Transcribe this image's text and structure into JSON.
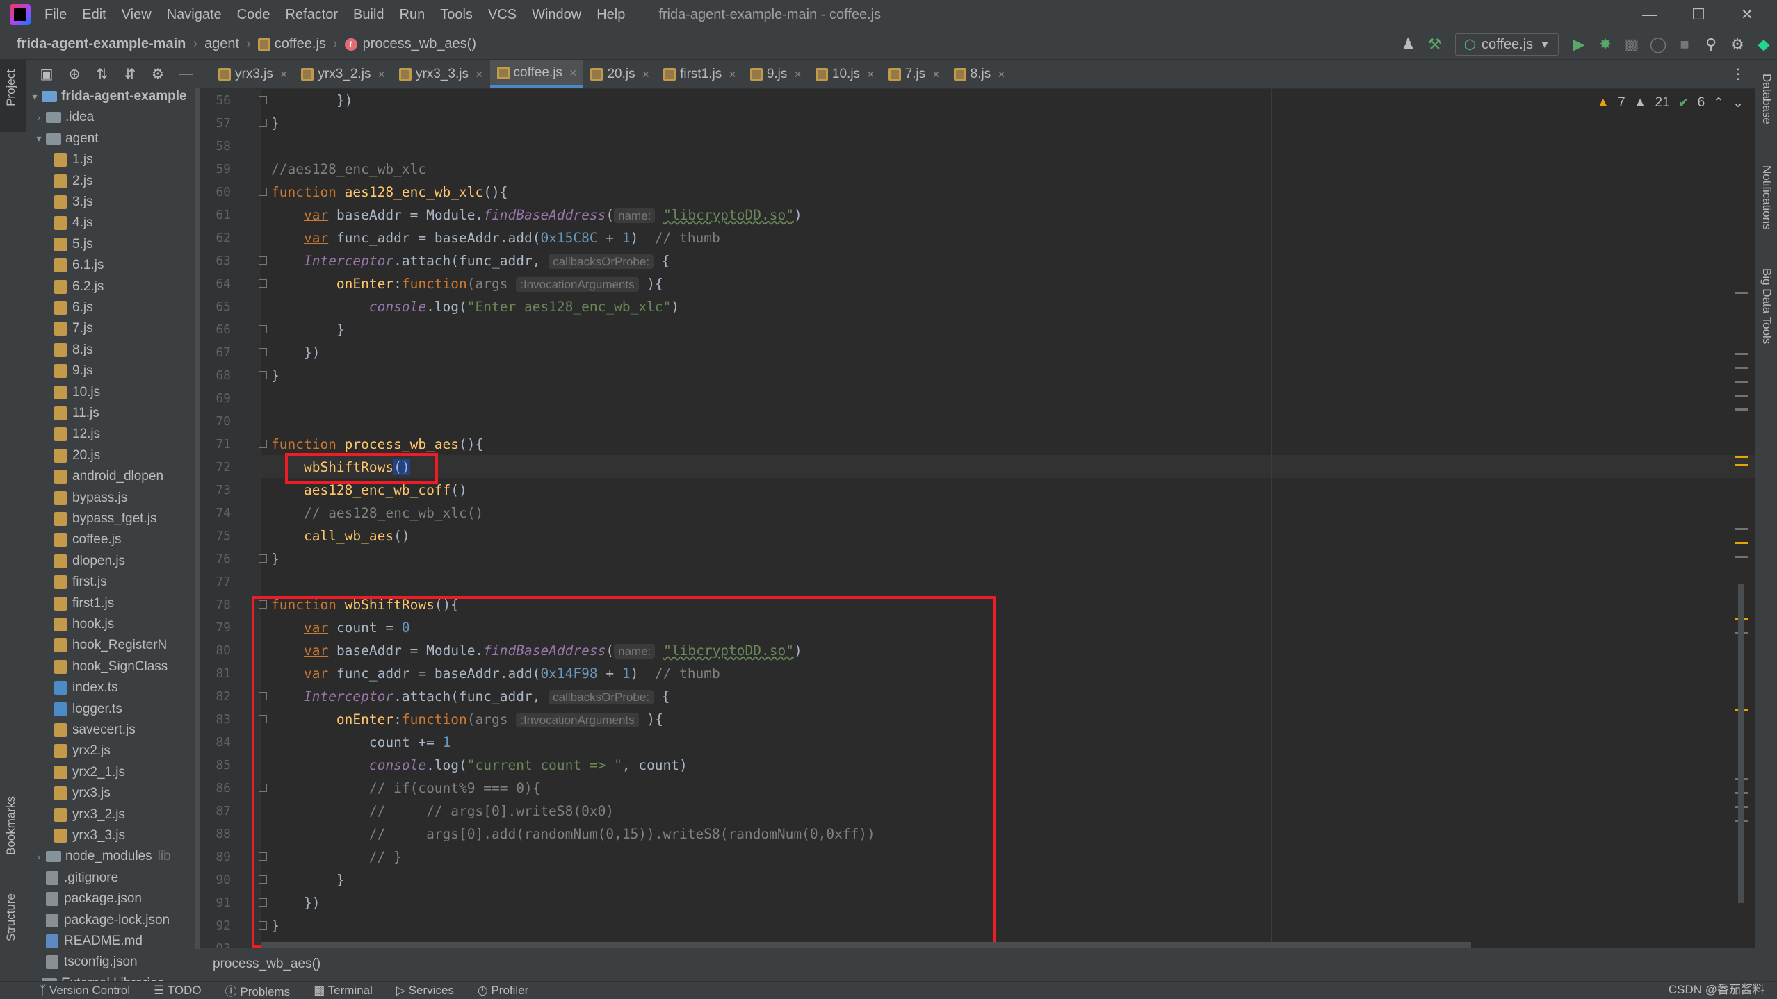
{
  "window": {
    "title": "frida-agent-example-main - coffee.js",
    "minimize": "—",
    "maximize": "☐",
    "close": "✕"
  },
  "menu": [
    "File",
    "Edit",
    "View",
    "Navigate",
    "Code",
    "Refactor",
    "Build",
    "Run",
    "Tools",
    "VCS",
    "Window",
    "Help"
  ],
  "breadcrumb": [
    "frida-agent-example-main",
    "agent",
    "coffee.js",
    "process_wb_aes()"
  ],
  "run_config": "coffee.js",
  "left_stripe": {
    "project": "Project",
    "bookmarks": "Bookmarks",
    "structure": "Structure"
  },
  "right_stripe": {
    "database": "Database",
    "notifications": "Notifications",
    "big_data": "Big Data Tools"
  },
  "tabs": [
    {
      "label": "yrx3.js",
      "active": false
    },
    {
      "label": "yrx3_2.js",
      "active": false
    },
    {
      "label": "yrx3_3.js",
      "active": false
    },
    {
      "label": "coffee.js",
      "active": true
    },
    {
      "label": "20.js",
      "active": false
    },
    {
      "label": "first1.js",
      "active": false
    },
    {
      "label": "9.js",
      "active": false
    },
    {
      "label": "10.js",
      "active": false
    },
    {
      "label": "7.js",
      "active": false
    },
    {
      "label": "8.js",
      "active": false
    }
  ],
  "inspections": {
    "warnings": "7",
    "weak_warnings": "21",
    "ok": "6"
  },
  "project_tree": [
    {
      "label": "frida-agent-example",
      "type": "folder-root",
      "depth": 0,
      "arrow": "▾"
    },
    {
      "label": ".idea",
      "type": "folder",
      "depth": 1,
      "arrow": "›"
    },
    {
      "label": "agent",
      "type": "folder",
      "depth": 1,
      "arrow": "▾"
    },
    {
      "label": "1.js",
      "type": "js",
      "depth": 2
    },
    {
      "label": "2.js",
      "type": "js",
      "depth": 2
    },
    {
      "label": "3.js",
      "type": "js",
      "depth": 2
    },
    {
      "label": "4.js",
      "type": "js",
      "depth": 2
    },
    {
      "label": "5.js",
      "type": "js",
      "depth": 2
    },
    {
      "label": "6.1.js",
      "type": "js",
      "depth": 2
    },
    {
      "label": "6.2.js",
      "type": "js",
      "depth": 2
    },
    {
      "label": "6.js",
      "type": "js",
      "depth": 2
    },
    {
      "label": "7.js",
      "type": "js",
      "depth": 2
    },
    {
      "label": "8.js",
      "type": "js",
      "depth": 2
    },
    {
      "label": "9.js",
      "type": "js",
      "depth": 2
    },
    {
      "label": "10.js",
      "type": "js",
      "depth": 2
    },
    {
      "label": "11.js",
      "type": "js",
      "depth": 2
    },
    {
      "label": "12.js",
      "type": "js",
      "depth": 2
    },
    {
      "label": "20.js",
      "type": "js",
      "depth": 2
    },
    {
      "label": "android_dlopen",
      "type": "js",
      "depth": 2
    },
    {
      "label": "bypass.js",
      "type": "js",
      "depth": 2
    },
    {
      "label": "bypass_fget.js",
      "type": "js",
      "depth": 2
    },
    {
      "label": "coffee.js",
      "type": "js",
      "depth": 2
    },
    {
      "label": "dlopen.js",
      "type": "js",
      "depth": 2
    },
    {
      "label": "first.js",
      "type": "js",
      "depth": 2
    },
    {
      "label": "first1.js",
      "type": "js",
      "depth": 2
    },
    {
      "label": "hook.js",
      "type": "js",
      "depth": 2
    },
    {
      "label": "hook_RegisterN",
      "type": "js",
      "depth": 2
    },
    {
      "label": "hook_SignClass",
      "type": "js",
      "depth": 2
    },
    {
      "label": "index.ts",
      "type": "ts",
      "depth": 2
    },
    {
      "label": "logger.ts",
      "type": "ts",
      "depth": 2
    },
    {
      "label": "savecert.js",
      "type": "js",
      "depth": 2
    },
    {
      "label": "yrx2.js",
      "type": "js",
      "depth": 2
    },
    {
      "label": "yrx2_1.js",
      "type": "js",
      "depth": 2
    },
    {
      "label": "yrx3.js",
      "type": "js",
      "depth": 2
    },
    {
      "label": "yrx3_2.js",
      "type": "js",
      "depth": 2
    },
    {
      "label": "yrx3_3.js",
      "type": "js",
      "depth": 2
    },
    {
      "label": "node_modules",
      "suffix": "lib",
      "type": "folder",
      "depth": 1,
      "arrow": "›"
    },
    {
      "label": ".gitignore",
      "type": "gen",
      "depth": 1
    },
    {
      "label": "package.json",
      "type": "gen",
      "depth": 1
    },
    {
      "label": "package-lock.json",
      "type": "gen",
      "depth": 1
    },
    {
      "label": "README.md",
      "type": "md",
      "depth": 1
    },
    {
      "label": "tsconfig.json",
      "type": "gen",
      "depth": 1
    },
    {
      "label": "External Libraries",
      "type": "folder",
      "depth": 0,
      "arrow": "›"
    }
  ],
  "line_numbers": [
    "56",
    "57",
    "58",
    "59",
    "60",
    "61",
    "62",
    "63",
    "64",
    "65",
    "66",
    "67",
    "68",
    "69",
    "70",
    "71",
    "72",
    "73",
    "74",
    "75",
    "76",
    "77",
    "78",
    "79",
    "80",
    "81",
    "82",
    "83",
    "84",
    "85",
    "86",
    "87",
    "88",
    "89",
    "90",
    "91",
    "92",
    "93"
  ],
  "code": {
    "l56": "        })",
    "l57": "}",
    "l59": "//aes128_enc_wb_xlc",
    "l60_kw": "function ",
    "l60_fn": "aes128_enc_wb_xlc",
    "l60_rest": "(){",
    "l61_var": "var",
    "l61_a": " baseAddr = Module.",
    "l61_m": "findBaseAddress",
    "l61_b": "(",
    "l61_hint": "name:",
    "l61_str": "\"libcryptoDD.so\"",
    "l61_c": ")",
    "l62_var": "var",
    "l62_a": " func_addr = baseAddr.add(",
    "l62_num": "0x15C8C",
    "l62_b": " + ",
    "l62_num2": "1",
    "l62_c": ")  ",
    "l62_cm": "// thumb",
    "l63_it": "Interceptor",
    "l63_a": ".attach(func_addr, ",
    "l63_hint": "callbacksOrProbe:",
    "l63_b": " {",
    "l64_fn": "onEnter",
    "l64_a": ":",
    "l64_kw": "function",
    "l64_b": "(args ",
    "l64_hint": ":InvocationArguments",
    "l64_c": " ){",
    "l65_it": "console",
    "l65_a": ".log(",
    "l65_str": "\"Enter aes128_enc_wb_xlc\"",
    "l65_b": ")",
    "l66": "        }",
    "l67": "    })",
    "l68": "}",
    "l71_kw": "function ",
    "l71_fn": "process_wb_aes",
    "l71_rest": "(){",
    "l72_fn": "wbShiftRows",
    "l72_sel": "()",
    "l73_fn": "aes128_enc_wb_coff",
    "l73_rest": "()",
    "l74_cm": "// aes128_enc_wb_xlc()",
    "l75_fn": "call_wb_aes",
    "l75_rest": "()",
    "l76": "}",
    "l78_kw": "function ",
    "l78_fn": "wbShiftRows",
    "l78_rest": "(){",
    "l79_var": "var",
    "l79_a": " count = ",
    "l79_num": "0",
    "l80_var": "var",
    "l80_a": " baseAddr = Module.",
    "l80_m": "findBaseAddress",
    "l80_b": "(",
    "l80_hint": "name:",
    "l80_str": "\"libcryptoDD.so\"",
    "l80_c": ")",
    "l81_var": "var",
    "l81_a": " func_addr = baseAddr.add(",
    "l81_num": "0x14F98",
    "l81_b": " + ",
    "l81_num2": "1",
    "l81_c": ")  ",
    "l81_cm": "// thumb",
    "l82_it": "Interceptor",
    "l82_a": ".attach(func_addr, ",
    "l82_hint": "callbacksOrProbe:",
    "l82_b": " {",
    "l83_fn": "onEnter",
    "l83_a": ":",
    "l83_kw": "function",
    "l83_b": "(args ",
    "l83_hint": ":InvocationArguments",
    "l83_c": " ){",
    "l84_a": "count += ",
    "l84_num": "1",
    "l85_it": "console",
    "l85_a": ".log(",
    "l85_str": "\"current count => \"",
    "l85_b": ", count)",
    "l86_cm": "// if(count%9 === 0){",
    "l87_cm": "//     // args[0].writeS8(0x0)",
    "l88_cm": "//     args[0].add(randomNum(0,15)).writeS8(randomNum(0,0xff))",
    "l89_cm": "// }",
    "l90": "        }",
    "l91": "    })",
    "l92": "}"
  },
  "bottom_breadcrumb": "process_wb_aes()",
  "status_bar": [
    "Version Control",
    "TODO",
    "Problems",
    "Terminal",
    "Services",
    "Profiler"
  ],
  "watermark": "CSDN @番茄酱料"
}
